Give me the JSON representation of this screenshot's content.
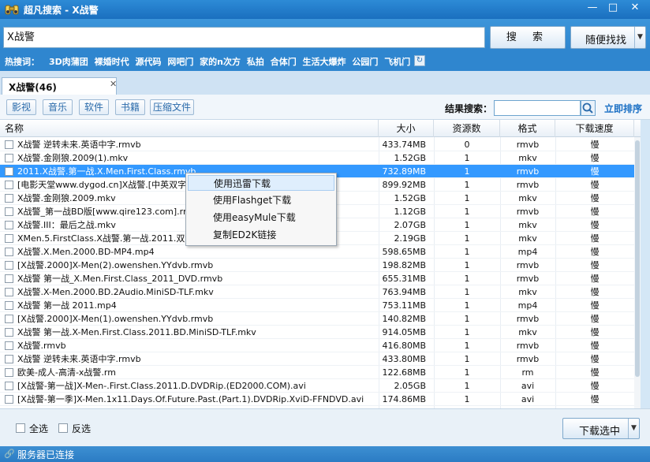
{
  "window": {
    "title": "超凡搜索 - X战警",
    "min": "—",
    "max": "□",
    "close": "✕"
  },
  "search": {
    "query": "X战警",
    "search_button": "搜 索",
    "random_button": "随便找找"
  },
  "hot": {
    "label": "热搜词：",
    "items": [
      "3D肉蒲团",
      "裸婚时代",
      "源代码",
      "网吧门",
      "家的n次方",
      "私拍",
      "合体门",
      "生活大爆炸",
      "公园门",
      "飞机门"
    ]
  },
  "tab": {
    "label": "X战警(46)",
    "close": "✕"
  },
  "filters": {
    "buttons": [
      "影视",
      "音乐",
      "软件",
      "书籍",
      "压缩文件"
    ],
    "result_search_label": "结果搜索：",
    "result_search_value": "",
    "sort_now": "立即排序"
  },
  "columns": {
    "name": "名称",
    "size": "大小",
    "sources": "资源数",
    "format": "格式",
    "speed": "下载速度"
  },
  "rows": [
    {
      "name": "X战警 逆转未来.英语中字.rmvb",
      "size": "433.74MB",
      "sources": "0",
      "format": "rmvb",
      "speed": "慢"
    },
    {
      "name": "X战警.金刚狼.2009(1).mkv",
      "size": "1.52GB",
      "sources": "1",
      "format": "mkv",
      "speed": "慢"
    },
    {
      "name": "2011.X战警.第一战.X.Men.First.Class.rmvb",
      "size": "732.89MB",
      "sources": "1",
      "format": "rmvb",
      "speed": "慢"
    },
    {
      "name": "[电影天堂www.dygod.cn]X战警.[中英双字",
      "size": "899.92MB",
      "sources": "1",
      "format": "rmvb",
      "speed": "慢"
    },
    {
      "name": "X战警.金刚狼.2009.mkv",
      "size": "1.52GB",
      "sources": "1",
      "format": "mkv",
      "speed": "慢"
    },
    {
      "name": "X战警_第一战BD版[www.qire123.com].rmv",
      "size": "1.12GB",
      "sources": "1",
      "format": "rmvb",
      "speed": "慢"
    },
    {
      "name": "X战警.III：最后之战.mkv",
      "size": "2.07GB",
      "sources": "1",
      "format": "mkv",
      "speed": "慢"
    },
    {
      "name": "XMen.5.FirstClass.X战警.第一战.2011.双语",
      "size": "2.19GB",
      "sources": "1",
      "format": "mkv",
      "speed": "慢"
    },
    {
      "name": "X战警.X.Men.2000.BD-MP4.mp4",
      "size": "598.65MB",
      "sources": "1",
      "format": "mp4",
      "speed": "慢"
    },
    {
      "name": "[X战警.2000]X-Men(2).owenshen.YYdvb.rmvb",
      "size": "198.82MB",
      "sources": "1",
      "format": "rmvb",
      "speed": "慢"
    },
    {
      "name": "X战警 第一战_X.Men.First.Class_2011_DVD.rmvb",
      "size": "655.31MB",
      "sources": "1",
      "format": "rmvb",
      "speed": "慢"
    },
    {
      "name": "X战警.X-Men.2000.BD.2Audio.MiniSD-TLF.mkv",
      "size": "763.94MB",
      "sources": "1",
      "format": "mkv",
      "speed": "慢"
    },
    {
      "name": "X战警 第一战 2011.mp4",
      "size": "753.11MB",
      "sources": "1",
      "format": "mp4",
      "speed": "慢"
    },
    {
      "name": "[X战警.2000]X-Men(1).owenshen.YYdvb.rmvb",
      "size": "140.82MB",
      "sources": "1",
      "format": "rmvb",
      "speed": "慢"
    },
    {
      "name": "X战警 第一战.X-Men.First.Class.2011.BD.MiniSD-TLF.mkv",
      "size": "914.05MB",
      "sources": "1",
      "format": "mkv",
      "speed": "慢"
    },
    {
      "name": "X战警.rmvb",
      "size": "416.80MB",
      "sources": "1",
      "format": "rmvb",
      "speed": "慢"
    },
    {
      "name": "X战警 逆转未来.英语中字.rmvb",
      "size": "433.80MB",
      "sources": "1",
      "format": "rmvb",
      "speed": "慢"
    },
    {
      "name": "欧美-成人-高清-x战警.rm",
      "size": "122.68MB",
      "sources": "1",
      "format": "rm",
      "speed": "慢"
    },
    {
      "name": "[X战警-第一战]X-Men-.First.Class.2011.D.DVDRip.(ED2000.COM).avi",
      "size": "2.05GB",
      "sources": "1",
      "format": "avi",
      "speed": "慢"
    },
    {
      "name": "[X战警-第一季]X-Men.1x11.Days.Of.Future.Past.(Part.1).DVDRip.XviD-FFNDVD.avi",
      "size": "174.86MB",
      "sources": "1",
      "format": "avi",
      "speed": "慢"
    }
  ],
  "context_menu": [
    "使用迅雷下载",
    "使用Flashget下载",
    "使用easyMule下载",
    "复制ED2K链接"
  ],
  "bottom": {
    "select_all": "全选",
    "invert": "反选",
    "download_selected": "下载选中"
  },
  "status": {
    "text": "服务器已连接"
  },
  "colors": {
    "title_bar": "#1a6fbf",
    "selection": "#3399ff",
    "link": "#1a6fc4"
  }
}
